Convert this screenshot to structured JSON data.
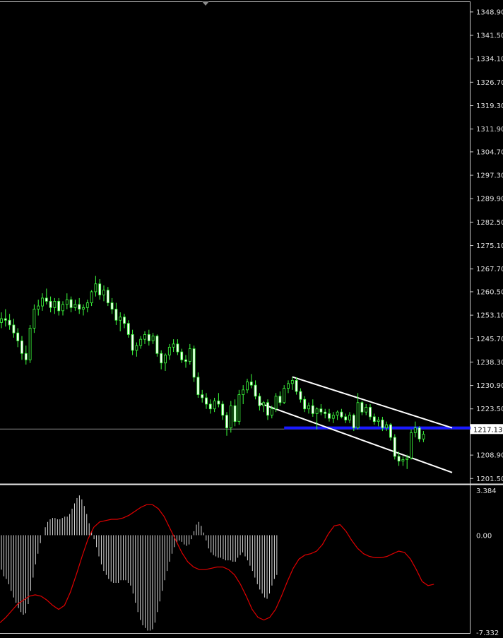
{
  "chart_data": [
    {
      "type": "candlestick",
      "panel": "price",
      "title": "",
      "y_ticks": [
        "1348.90",
        "1341.50",
        "1334.10",
        "1326.70",
        "1319.30",
        "1311.90",
        "1304.70",
        "1297.30",
        "1289.90",
        "1282.50",
        "1275.10",
        "1267.70",
        "1260.50",
        "1253.10",
        "1245.70",
        "1238.30",
        "1230.90",
        "1223.50",
        "1208.90",
        "1201.50"
      ],
      "ylim": [
        1200.0,
        1352.0
      ],
      "current_price": 1217.13,
      "current_price_label": "1217.13",
      "support_level": 1217.5,
      "channel": {
        "upper": [
          [
            71,
            1233.6
          ],
          [
            110,
            1217.5
          ]
        ],
        "lower": [
          [
            63,
            1225.3
          ],
          [
            110,
            1203.4
          ]
        ]
      },
      "candles": [
        [
          1250.8,
          1254.0,
          1249.0,
          1252.0
        ],
        [
          1252.0,
          1255.0,
          1249.5,
          1251.5
        ],
        [
          1251.5,
          1253.5,
          1248.5,
          1250.0
        ],
        [
          1250.0,
          1252.0,
          1246.0,
          1247.5
        ],
        [
          1247.5,
          1249.0,
          1243.0,
          1245.0
        ],
        [
          1245.0,
          1246.5,
          1239.0,
          1241.0
        ],
        [
          1241.0,
          1243.5,
          1237.5,
          1239.0
        ],
        [
          1239.0,
          1250.0,
          1238.0,
          1249.0
        ],
        [
          1249.0,
          1256.5,
          1247.5,
          1255.0
        ],
        [
          1255.0,
          1258.0,
          1253.0,
          1256.0
        ],
        [
          1256.0,
          1260.0,
          1254.5,
          1258.5
        ],
        [
          1258.5,
          1261.5,
          1256.5,
          1257.5
        ],
        [
          1257.5,
          1259.0,
          1254.0,
          1255.5
        ],
        [
          1255.5,
          1258.5,
          1253.5,
          1257.5
        ],
        [
          1257.5,
          1258.5,
          1253.0,
          1254.5
        ],
        [
          1254.5,
          1257.5,
          1253.0,
          1256.5
        ],
        [
          1256.5,
          1260.0,
          1255.0,
          1258.0
        ],
        [
          1258.0,
          1259.0,
          1254.0,
          1255.5
        ],
        [
          1255.5,
          1258.0,
          1254.5,
          1256.5
        ],
        [
          1256.5,
          1258.5,
          1253.5,
          1255.0
        ],
        [
          1255.0,
          1256.5,
          1253.0,
          1255.5
        ],
        [
          1255.5,
          1258.0,
          1254.0,
          1257.0
        ],
        [
          1257.0,
          1261.0,
          1256.0,
          1260.5
        ],
        [
          1260.5,
          1265.5,
          1259.0,
          1263.0
        ],
        [
          1263.0,
          1264.5,
          1258.0,
          1259.5
        ],
        [
          1259.5,
          1262.5,
          1257.5,
          1261.0
        ],
        [
          1261.0,
          1262.0,
          1256.0,
          1257.0
        ],
        [
          1257.0,
          1258.5,
          1253.5,
          1255.0
        ],
        [
          1255.0,
          1257.0,
          1250.0,
          1251.5
        ],
        [
          1251.5,
          1254.0,
          1248.0,
          1252.5
        ],
        [
          1252.5,
          1253.5,
          1249.0,
          1250.5
        ],
        [
          1250.5,
          1251.5,
          1246.0,
          1247.0
        ],
        [
          1247.0,
          1248.5,
          1240.5,
          1242.0
        ],
        [
          1242.0,
          1244.5,
          1240.0,
          1243.5
        ],
        [
          1243.5,
          1246.5,
          1242.5,
          1245.5
        ],
        [
          1245.5,
          1248.0,
          1244.0,
          1247.0
        ],
        [
          1247.0,
          1248.5,
          1243.5,
          1245.0
        ],
        [
          1245.0,
          1247.5,
          1244.0,
          1246.5
        ],
        [
          1246.5,
          1247.0,
          1240.0,
          1241.0
        ],
        [
          1241.0,
          1242.0,
          1236.0,
          1238.0
        ],
        [
          1238.0,
          1241.0,
          1235.5,
          1240.5
        ],
        [
          1240.5,
          1244.0,
          1239.0,
          1243.0
        ],
        [
          1243.0,
          1245.5,
          1241.5,
          1244.0
        ],
        [
          1244.0,
          1245.5,
          1240.5,
          1241.5
        ],
        [
          1241.5,
          1242.5,
          1238.0,
          1239.0
        ],
        [
          1239.0,
          1240.5,
          1236.5,
          1238.5
        ],
        [
          1238.5,
          1244.0,
          1237.5,
          1242.5
        ],
        [
          1242.5,
          1243.5,
          1232.0,
          1233.5
        ],
        [
          1233.5,
          1235.0,
          1227.0,
          1228.0
        ],
        [
          1228.0,
          1229.5,
          1225.5,
          1227.0
        ],
        [
          1227.0,
          1228.5,
          1223.5,
          1225.0
        ],
        [
          1225.0,
          1226.5,
          1222.0,
          1223.5
        ],
        [
          1223.5,
          1227.0,
          1222.5,
          1226.0
        ],
        [
          1226.0,
          1228.5,
          1224.0,
          1225.0
        ],
        [
          1225.0,
          1226.0,
          1220.0,
          1221.5
        ],
        [
          1221.5,
          1222.5,
          1215.0,
          1217.5
        ],
        [
          1217.5,
          1226.0,
          1216.0,
          1224.5
        ],
        [
          1224.5,
          1226.5,
          1218.0,
          1219.5
        ],
        [
          1219.5,
          1229.5,
          1218.5,
          1228.0
        ],
        [
          1228.0,
          1231.0,
          1225.0,
          1229.5
        ],
        [
          1229.5,
          1233.0,
          1228.5,
          1232.0
        ],
        [
          1232.0,
          1234.5,
          1230.0,
          1231.0
        ],
        [
          1231.0,
          1232.5,
          1226.5,
          1227.5
        ],
        [
          1227.5,
          1228.5,
          1223.0,
          1224.5
        ],
        [
          1224.5,
          1226.0,
          1222.5,
          1225.5
        ],
        [
          1225.5,
          1226.5,
          1220.0,
          1221.5
        ],
        [
          1221.5,
          1224.5,
          1220.5,
          1223.5
        ],
        [
          1223.5,
          1228.5,
          1222.5,
          1227.5
        ],
        [
          1227.5,
          1229.0,
          1224.5,
          1225.5
        ],
        [
          1225.5,
          1231.0,
          1225.0,
          1230.0
        ],
        [
          1230.0,
          1232.5,
          1228.5,
          1231.5
        ],
        [
          1231.5,
          1233.5,
          1229.5,
          1232.5
        ],
        [
          1232.5,
          1233.5,
          1228.0,
          1229.0
        ],
        [
          1229.0,
          1230.0,
          1225.5,
          1226.5
        ],
        [
          1226.5,
          1227.5,
          1222.5,
          1223.5
        ],
        [
          1223.5,
          1225.5,
          1222.0,
          1224.5
        ],
        [
          1224.5,
          1226.5,
          1221.0,
          1222.0
        ],
        [
          1222.0,
          1224.0,
          1217.0,
          1223.5
        ],
        [
          1223.5,
          1225.0,
          1221.5,
          1222.5
        ],
        [
          1222.5,
          1223.5,
          1220.5,
          1222.0
        ],
        [
          1222.0,
          1223.5,
          1219.5,
          1220.5
        ],
        [
          1220.5,
          1222.5,
          1219.0,
          1221.5
        ],
        [
          1221.5,
          1223.0,
          1220.0,
          1222.5
        ],
        [
          1222.5,
          1223.5,
          1220.5,
          1221.0
        ],
        [
          1221.0,
          1222.0,
          1219.0,
          1220.0
        ],
        [
          1220.0,
          1222.5,
          1219.0,
          1221.5
        ],
        [
          1221.5,
          1222.0,
          1216.5,
          1217.5
        ],
        [
          1217.5,
          1228.5,
          1217.0,
          1225.5
        ],
        [
          1225.5,
          1226.0,
          1221.5,
          1222.5
        ],
        [
          1222.5,
          1225.0,
          1221.5,
          1224.0
        ],
        [
          1224.0,
          1225.0,
          1220.0,
          1221.0
        ],
        [
          1221.0,
          1222.0,
          1218.5,
          1219.5
        ],
        [
          1219.5,
          1221.0,
          1218.0,
          1220.0
        ],
        [
          1220.0,
          1221.0,
          1216.5,
          1217.5
        ],
        [
          1217.5,
          1219.5,
          1216.5,
          1218.5
        ],
        [
          1218.5,
          1219.0,
          1213.5,
          1214.5
        ],
        [
          1214.5,
          1215.5,
          1207.5,
          1208.5
        ],
        [
          1208.5,
          1210.0,
          1205.5,
          1207.0
        ],
        [
          1207.0,
          1208.5,
          1205.5,
          1207.5
        ],
        [
          1207.5,
          1209.0,
          1204.5,
          1208.0
        ],
        [
          1208.0,
          1217.0,
          1207.5,
          1216.0
        ],
        [
          1216.0,
          1219.5,
          1214.5,
          1217.5
        ],
        [
          1217.5,
          1218.0,
          1213.0,
          1214.0
        ],
        [
          1214.0,
          1216.5,
          1213.0,
          1215.5
        ]
      ]
    },
    {
      "type": "histogram",
      "panel": "oscillator",
      "y_ticks": [
        "3.384",
        "0.00",
        "-7.332"
      ],
      "ylim": [
        -7.332,
        3.384
      ],
      "histogram": [
        -2.6,
        -3.1,
        -3.3,
        -3.7,
        -4.2,
        -4.7,
        -5.1,
        -5.5,
        -5.8,
        -6.0,
        -5.9,
        -5.2,
        -4.2,
        -3.2,
        -2.2,
        -1.4,
        -0.6,
        0.0,
        0.6,
        1.0,
        1.2,
        1.3,
        1.3,
        1.2,
        1.2,
        1.3,
        1.4,
        1.4,
        1.6,
        2.0,
        2.4,
        2.8,
        3.0,
        2.7,
        2.2,
        1.6,
        0.9,
        0.3,
        -0.3,
        -0.9,
        -1.6,
        -2.2,
        -2.7,
        -3.0,
        -3.3,
        -3.5,
        -3.6,
        -3.6,
        -3.6,
        -3.4,
        -3.4,
        -3.4,
        -3.6,
        -3.8,
        -4.4,
        -5.1,
        -5.8,
        -6.4,
        -6.8,
        -7.0,
        -7.2,
        -7.2,
        -7.1,
        -6.6,
        -5.8,
        -5.0,
        -4.2,
        -3.4,
        -2.7,
        -2.0,
        -1.4,
        -0.9,
        -0.6,
        -0.4,
        -0.5,
        -0.7,
        -0.8,
        -0.7,
        -0.3,
        0.3,
        0.8,
        1.0,
        0.7,
        0.2,
        -0.4,
        -1.0,
        -1.3,
        -1.5,
        -1.6,
        -1.7,
        -1.7,
        -1.8,
        -1.9,
        -1.9,
        -1.9,
        -2.0,
        -2.0,
        -1.7,
        -1.5,
        -1.3,
        -1.6,
        -1.9,
        -2.3,
        -2.7,
        -3.2,
        -3.7,
        -4.1,
        -4.4,
        -4.7,
        -4.8,
        -4.4,
        -3.8,
        -3.3,
        -3.0
      ],
      "signal": [
        -6.6,
        -6.2,
        -5.7,
        -5.2,
        -4.9,
        -4.6,
        -4.5,
        -4.6,
        -4.9,
        -5.3,
        -5.6,
        -5.3,
        -4.3,
        -3.0,
        -1.6,
        -0.3,
        0.6,
        1.0,
        1.1,
        1.2,
        1.2,
        1.3,
        1.5,
        1.8,
        2.1,
        2.3,
        2.3,
        2.0,
        1.4,
        0.5,
        -0.4,
        -1.3,
        -2.0,
        -2.4,
        -2.6,
        -2.6,
        -2.5,
        -2.4,
        -2.4,
        -2.6,
        -3.0,
        -3.7,
        -4.6,
        -5.6,
        -6.2,
        -6.4,
        -6.2,
        -5.6,
        -4.6,
        -3.5,
        -2.5,
        -1.8,
        -1.5,
        -1.4,
        -1.2,
        -0.7,
        0.1,
        0.7,
        0.8,
        0.3,
        -0.4,
        -1.0,
        -1.4,
        -1.6,
        -1.7,
        -1.7,
        -1.6,
        -1.4,
        -1.2,
        -1.3,
        -1.8,
        -2.6,
        -3.5,
        -3.8,
        -3.7
      ]
    }
  ]
}
